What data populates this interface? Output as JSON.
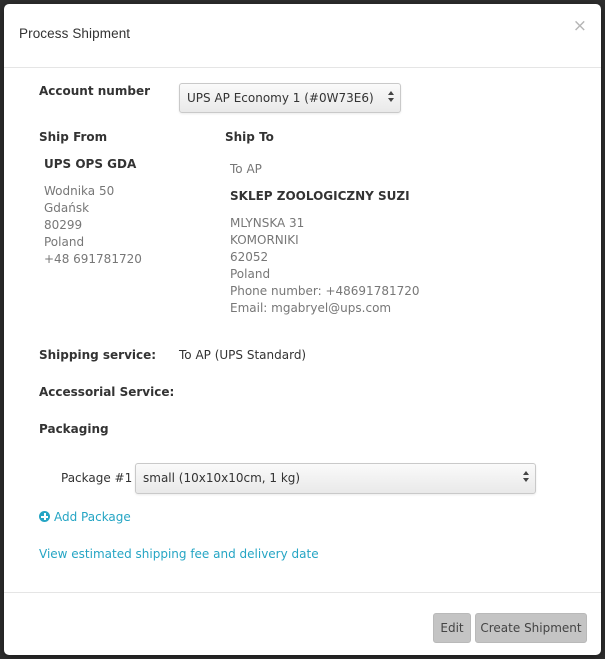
{
  "modal": {
    "title": "Process Shipment",
    "close_glyph": "×"
  },
  "account": {
    "label": "Account number",
    "selected": "UPS AP Economy 1 (#0W73E6)"
  },
  "ship_from": {
    "heading": "Ship From",
    "name": "UPS OPS GDA",
    "address_lines": [
      "Wodnika 50",
      "Gdańsk",
      "80299",
      "Poland",
      "+48 691781720"
    ]
  },
  "ship_to": {
    "heading": "Ship To",
    "type": "To AP",
    "name": "SKLEP ZOOLOGICZNY SUZI",
    "address_lines": [
      "MLYNSKA 31",
      "KOMORNIKI",
      "62052",
      "Poland",
      "Phone number: +48691781720",
      "Email: mgabryel@ups.com"
    ]
  },
  "shipping_service": {
    "label": "Shipping service:",
    "value": "To AP (UPS Standard)"
  },
  "accessorial_service": {
    "label": "Accessorial Service:"
  },
  "packaging": {
    "label": "Packaging",
    "packages": [
      {
        "label": "Package #1",
        "selected": "small (10x10x10cm, 1 kg)"
      }
    ],
    "add_package_label": "Add Package"
  },
  "estimate_link": "View estimated shipping fee and delivery date",
  "footer": {
    "edit_label": "Edit",
    "create_label": "Create Shipment"
  },
  "icons": {
    "close": "close-icon",
    "add": "plus-circle-icon",
    "select_arrows": "chevron-updown-icon"
  },
  "colors": {
    "link": "#25a5c4",
    "button_bg": "#c4c4c4"
  }
}
